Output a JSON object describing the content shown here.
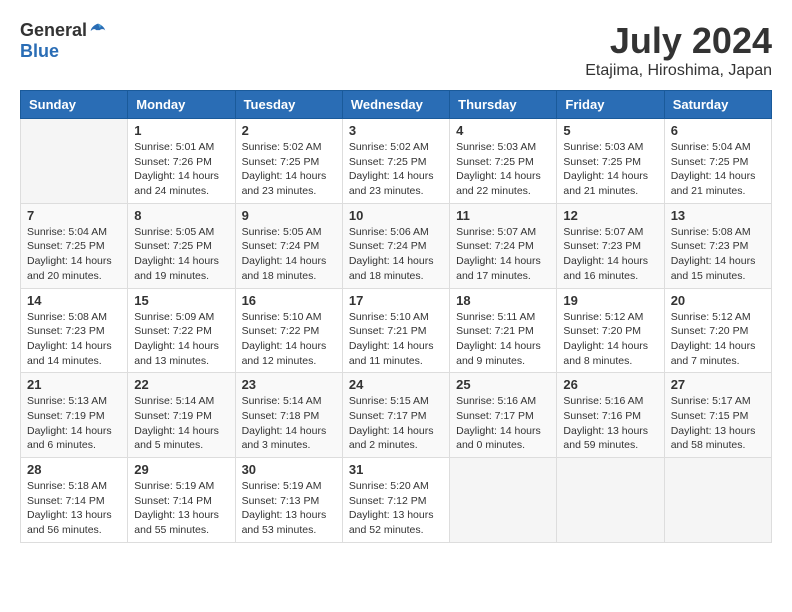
{
  "header": {
    "logo_general": "General",
    "logo_blue": "Blue",
    "month_title": "July 2024",
    "location": "Etajima, Hiroshima, Japan"
  },
  "calendar": {
    "days_of_week": [
      "Sunday",
      "Monday",
      "Tuesday",
      "Wednesday",
      "Thursday",
      "Friday",
      "Saturday"
    ],
    "weeks": [
      [
        {
          "day": "",
          "info": ""
        },
        {
          "day": "1",
          "info": "Sunrise: 5:01 AM\nSunset: 7:26 PM\nDaylight: 14 hours\nand 24 minutes."
        },
        {
          "day": "2",
          "info": "Sunrise: 5:02 AM\nSunset: 7:25 PM\nDaylight: 14 hours\nand 23 minutes."
        },
        {
          "day": "3",
          "info": "Sunrise: 5:02 AM\nSunset: 7:25 PM\nDaylight: 14 hours\nand 23 minutes."
        },
        {
          "day": "4",
          "info": "Sunrise: 5:03 AM\nSunset: 7:25 PM\nDaylight: 14 hours\nand 22 minutes."
        },
        {
          "day": "5",
          "info": "Sunrise: 5:03 AM\nSunset: 7:25 PM\nDaylight: 14 hours\nand 21 minutes."
        },
        {
          "day": "6",
          "info": "Sunrise: 5:04 AM\nSunset: 7:25 PM\nDaylight: 14 hours\nand 21 minutes."
        }
      ],
      [
        {
          "day": "7",
          "info": "Sunrise: 5:04 AM\nSunset: 7:25 PM\nDaylight: 14 hours\nand 20 minutes."
        },
        {
          "day": "8",
          "info": "Sunrise: 5:05 AM\nSunset: 7:25 PM\nDaylight: 14 hours\nand 19 minutes."
        },
        {
          "day": "9",
          "info": "Sunrise: 5:05 AM\nSunset: 7:24 PM\nDaylight: 14 hours\nand 18 minutes."
        },
        {
          "day": "10",
          "info": "Sunrise: 5:06 AM\nSunset: 7:24 PM\nDaylight: 14 hours\nand 18 minutes."
        },
        {
          "day": "11",
          "info": "Sunrise: 5:07 AM\nSunset: 7:24 PM\nDaylight: 14 hours\nand 17 minutes."
        },
        {
          "day": "12",
          "info": "Sunrise: 5:07 AM\nSunset: 7:23 PM\nDaylight: 14 hours\nand 16 minutes."
        },
        {
          "day": "13",
          "info": "Sunrise: 5:08 AM\nSunset: 7:23 PM\nDaylight: 14 hours\nand 15 minutes."
        }
      ],
      [
        {
          "day": "14",
          "info": "Sunrise: 5:08 AM\nSunset: 7:23 PM\nDaylight: 14 hours\nand 14 minutes."
        },
        {
          "day": "15",
          "info": "Sunrise: 5:09 AM\nSunset: 7:22 PM\nDaylight: 14 hours\nand 13 minutes."
        },
        {
          "day": "16",
          "info": "Sunrise: 5:10 AM\nSunset: 7:22 PM\nDaylight: 14 hours\nand 12 minutes."
        },
        {
          "day": "17",
          "info": "Sunrise: 5:10 AM\nSunset: 7:21 PM\nDaylight: 14 hours\nand 11 minutes."
        },
        {
          "day": "18",
          "info": "Sunrise: 5:11 AM\nSunset: 7:21 PM\nDaylight: 14 hours\nand 9 minutes."
        },
        {
          "day": "19",
          "info": "Sunrise: 5:12 AM\nSunset: 7:20 PM\nDaylight: 14 hours\nand 8 minutes."
        },
        {
          "day": "20",
          "info": "Sunrise: 5:12 AM\nSunset: 7:20 PM\nDaylight: 14 hours\nand 7 minutes."
        }
      ],
      [
        {
          "day": "21",
          "info": "Sunrise: 5:13 AM\nSunset: 7:19 PM\nDaylight: 14 hours\nand 6 minutes."
        },
        {
          "day": "22",
          "info": "Sunrise: 5:14 AM\nSunset: 7:19 PM\nDaylight: 14 hours\nand 5 minutes."
        },
        {
          "day": "23",
          "info": "Sunrise: 5:14 AM\nSunset: 7:18 PM\nDaylight: 14 hours\nand 3 minutes."
        },
        {
          "day": "24",
          "info": "Sunrise: 5:15 AM\nSunset: 7:17 PM\nDaylight: 14 hours\nand 2 minutes."
        },
        {
          "day": "25",
          "info": "Sunrise: 5:16 AM\nSunset: 7:17 PM\nDaylight: 14 hours\nand 0 minutes."
        },
        {
          "day": "26",
          "info": "Sunrise: 5:16 AM\nSunset: 7:16 PM\nDaylight: 13 hours\nand 59 minutes."
        },
        {
          "day": "27",
          "info": "Sunrise: 5:17 AM\nSunset: 7:15 PM\nDaylight: 13 hours\nand 58 minutes."
        }
      ],
      [
        {
          "day": "28",
          "info": "Sunrise: 5:18 AM\nSunset: 7:14 PM\nDaylight: 13 hours\nand 56 minutes."
        },
        {
          "day": "29",
          "info": "Sunrise: 5:19 AM\nSunset: 7:14 PM\nDaylight: 13 hours\nand 55 minutes."
        },
        {
          "day": "30",
          "info": "Sunrise: 5:19 AM\nSunset: 7:13 PM\nDaylight: 13 hours\nand 53 minutes."
        },
        {
          "day": "31",
          "info": "Sunrise: 5:20 AM\nSunset: 7:12 PM\nDaylight: 13 hours\nand 52 minutes."
        },
        {
          "day": "",
          "info": ""
        },
        {
          "day": "",
          "info": ""
        },
        {
          "day": "",
          "info": ""
        }
      ]
    ]
  }
}
